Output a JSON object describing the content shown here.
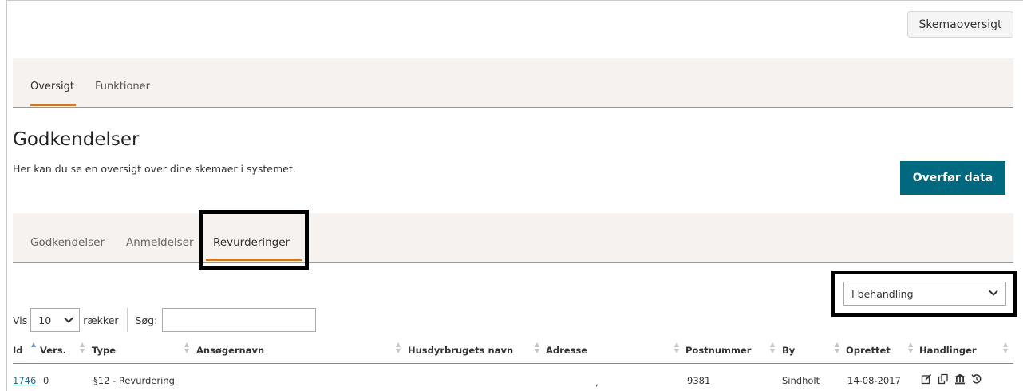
{
  "header": {
    "skema_button": "Skemaoversigt"
  },
  "subnav": {
    "tabs": [
      {
        "label": "Oversigt",
        "active": true
      },
      {
        "label": "Funktioner",
        "active": false
      }
    ]
  },
  "page": {
    "title": "Godkendelser",
    "subtitle": "Her kan du se en oversigt over dine skemaer i systemet.",
    "primary_button": "Overfør data"
  },
  "tabs": [
    {
      "label": "Godkendelser",
      "active": false
    },
    {
      "label": "Anmeldelser",
      "active": false
    },
    {
      "label": "Revurderinger",
      "active": true
    }
  ],
  "status_filter": {
    "selected": "I behandling"
  },
  "table_controls": {
    "show_label": "Vis",
    "length_value": "10",
    "rows_label": "rækker",
    "search_label": "Søg:",
    "search_value": ""
  },
  "table": {
    "columns": [
      "Id",
      "Vers.",
      "Type",
      "Ansøgernavn",
      "Husdyrbrugets navn",
      "Adresse",
      "Postnummer",
      "By",
      "Oprettet",
      "Handlinger"
    ],
    "rows": [
      {
        "id": "1746",
        "vers": "0",
        "type": "§12 - Revurdering",
        "ansoegernavn": "",
        "husdyrbrugets_navn": "",
        "adresse": ",",
        "postnummer": "9381",
        "by": "Sindholt",
        "oprettet": "14-08-2017"
      }
    ]
  },
  "colors": {
    "accent": "#c87a2e",
    "primary": "#00687f",
    "tab_bg": "#f6f2ef",
    "highlight": "#000000"
  },
  "icons": [
    "edit-icon",
    "copy-icon",
    "institution-icon",
    "history-icon"
  ]
}
